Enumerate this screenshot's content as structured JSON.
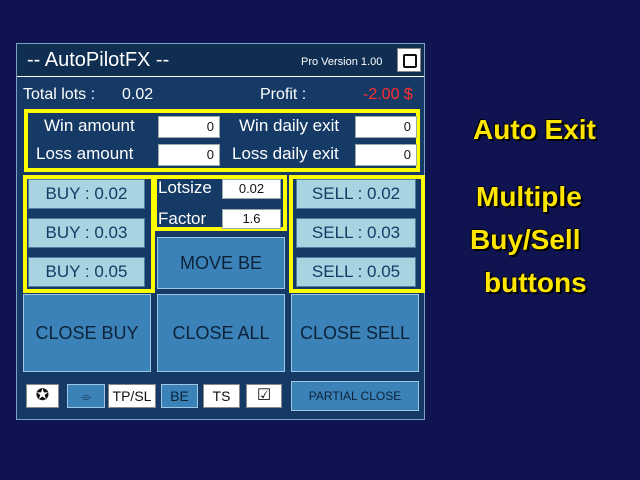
{
  "panel": {
    "title": "-- AutoPilotFX --",
    "version": "Pro Version 1.00",
    "total_lots_label": "Total lots :",
    "total_lots_value": "0.02",
    "profit_label": "Profit :",
    "profit_value": "-2.00 $"
  },
  "auto_exit": {
    "win_amount_label": "Win amount",
    "win_amount_value": "0",
    "win_daily_exit_label": "Win daily exit",
    "win_daily_exit_value": "0",
    "loss_amount_label": "Loss amount",
    "loss_amount_value": "0",
    "loss_daily_exit_label": "Loss daily exit",
    "loss_daily_exit_value": "0"
  },
  "buy_buttons": [
    "BUY : 0.02",
    "BUY : 0.03",
    "BUY : 0.05"
  ],
  "sell_buttons": [
    "SELL : 0.02",
    "SELL : 0.03",
    "SELL : 0.05"
  ],
  "lot": {
    "lotsize_label": "Lotsize",
    "lotsize_value": "0.02",
    "factor_label": "Factor",
    "factor_value": "1.6"
  },
  "actions": {
    "move_be": "MOVE BE",
    "close_buy": "CLOSE BUY",
    "close_all": "CLOSE ALL",
    "close_sell": "CLOSE SELL"
  },
  "toolbar": {
    "star": "✪",
    "grid": "⌯",
    "tpsl": "TP/SL",
    "be": "BE",
    "ts": "TS",
    "check": "☑",
    "partial_close": "PARTIAL CLOSE"
  },
  "promo": {
    "auto_exit": "Auto Exit",
    "line1": "Multiple",
    "line2": "Buy/Sell",
    "line3": "buttons"
  },
  "colors": {
    "background": "#0f1350",
    "panel": "#163a66",
    "highlight": "#ffff00",
    "promo_text": "#ffe600",
    "profit_negative": "#ff3030",
    "button_light": "#a8d3e0",
    "button_blue": "#3a82b8"
  }
}
